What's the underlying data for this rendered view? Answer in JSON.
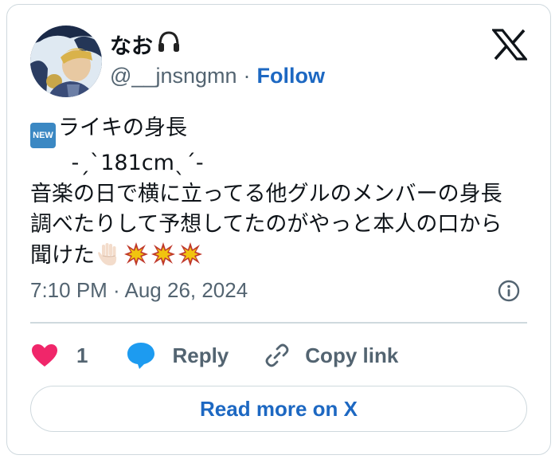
{
  "author": {
    "display_name": "なお",
    "handle": "@__jnsngmn",
    "separator": "·",
    "follow_label": "Follow"
  },
  "tweet": {
    "badge_text": "NEW",
    "lines": [
      "ライキの身長",
      "      -ˏˋ181cmˎˊ-",
      "音楽の日で横に立ってる他グルのメンバーの身長",
      "調べたりして予想してたのがやっと本人の口から",
      "聞けた"
    ],
    "emojis": [
      "raised-hand-emoji",
      "collision-emoji",
      "collision-emoji",
      "collision-emoji"
    ]
  },
  "timestamp": "7:10 PM · Aug 26, 2024",
  "actions": {
    "like_count": "1",
    "reply_label": "Reply",
    "copy_link_label": "Copy link"
  },
  "read_more_label": "Read more on X",
  "colors": {
    "accent": "#1d68c2",
    "heart": "#f0266a",
    "reply_bubble": "#1d9bf0",
    "muted_text": "#536471",
    "border": "#cfd9de"
  }
}
